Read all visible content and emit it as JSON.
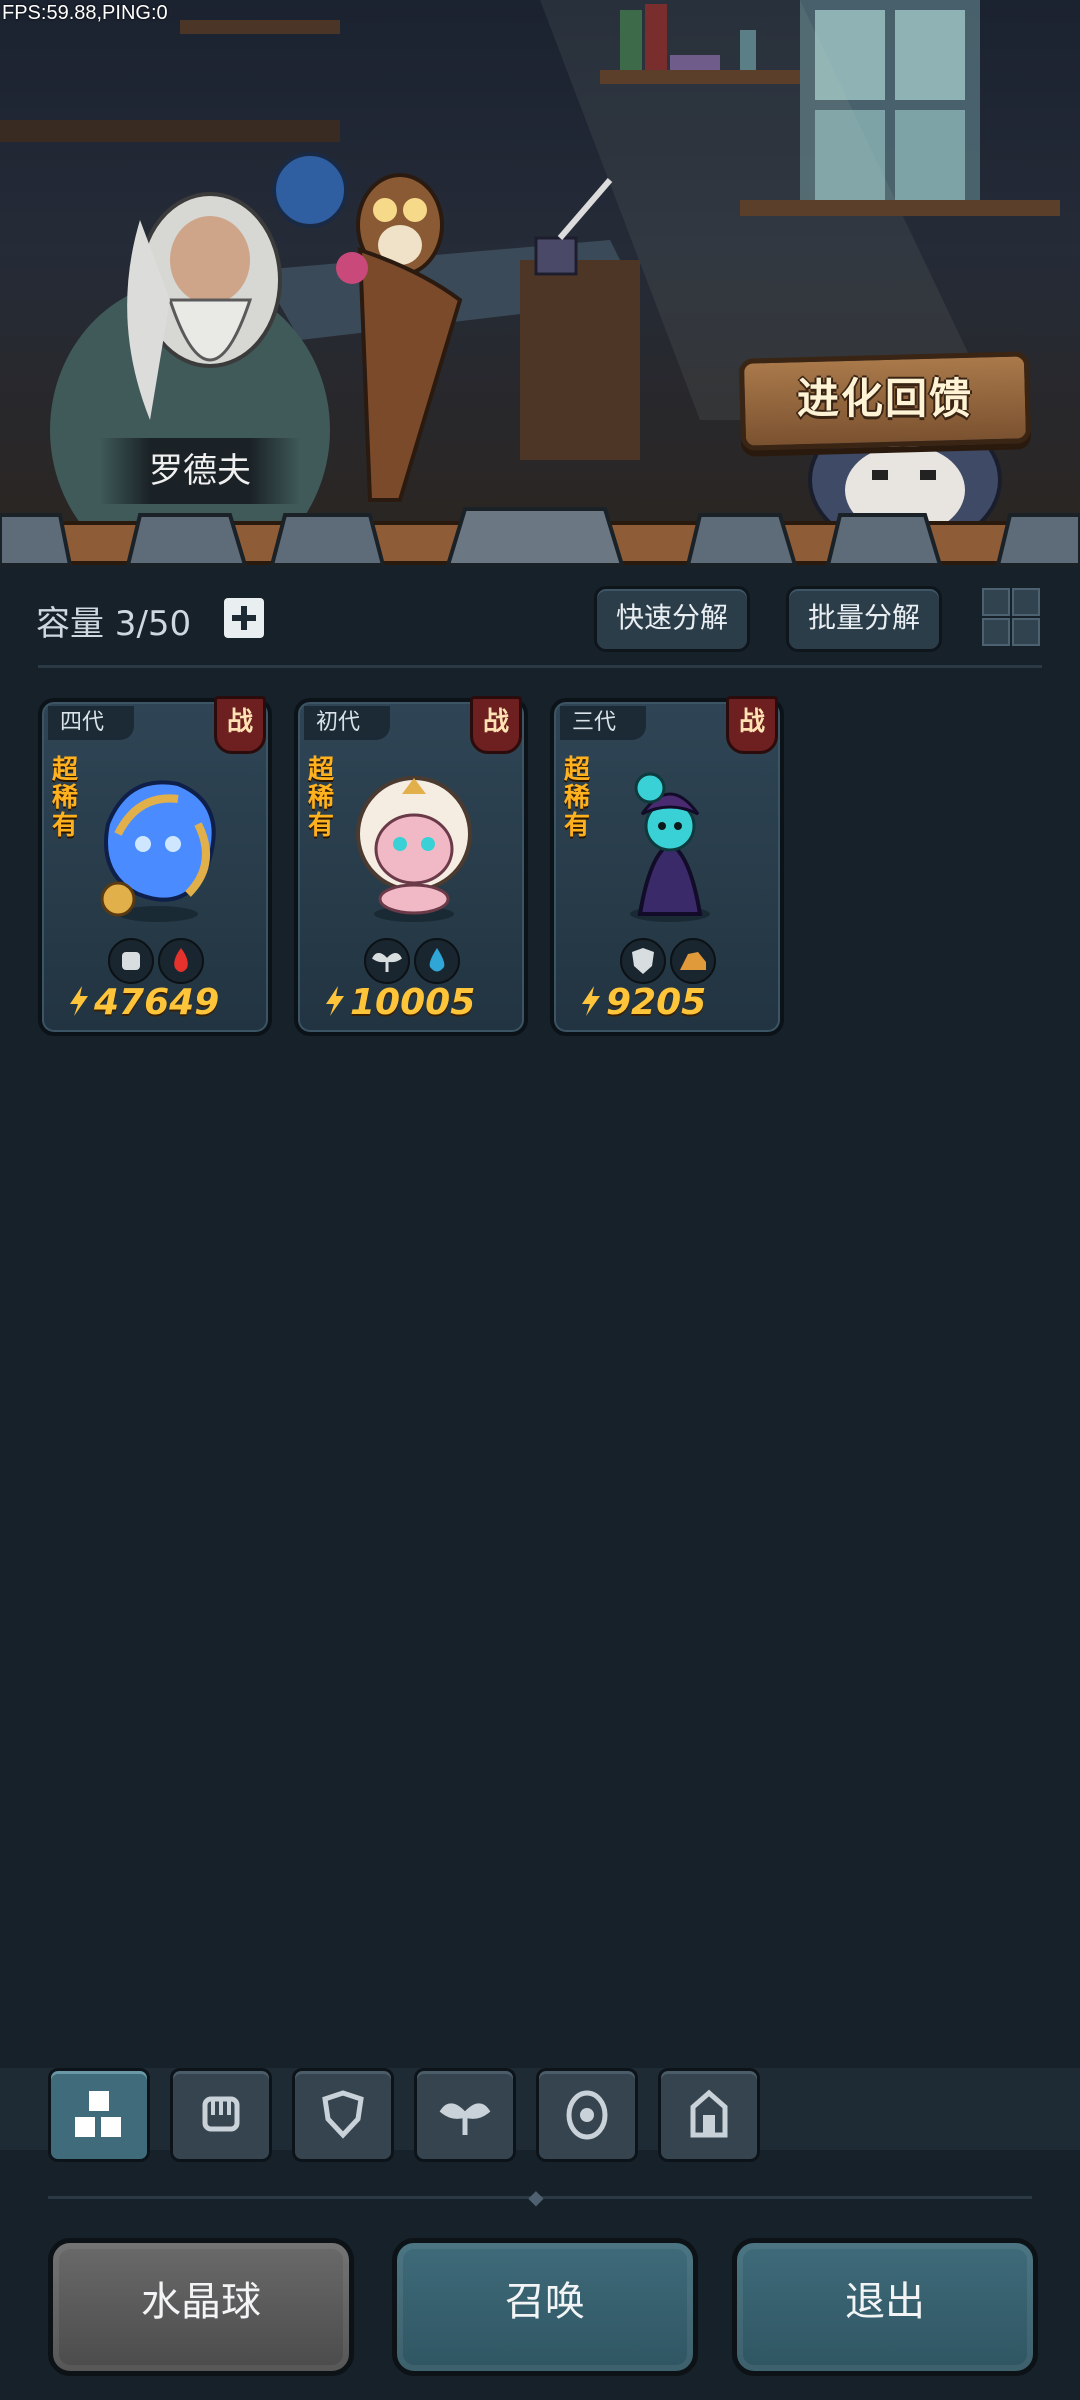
{
  "debug": {
    "fps_text": "FPS:59.88,PING:0"
  },
  "scene": {
    "npc_name": "罗德夫",
    "evolution_sign": "进化回馈"
  },
  "inventory": {
    "capacity_label": "容量 3/50",
    "quick_decompose": "快速分解",
    "batch_decompose": "批量分解"
  },
  "cards": [
    {
      "generation": "四代",
      "battle": "战",
      "rarity": "超稀有",
      "power": "47649",
      "traits": [
        "fist-icon",
        "fire-icon"
      ],
      "accent": "#4a8cff"
    },
    {
      "generation": "初代",
      "battle": "战",
      "rarity": "超稀有",
      "power": "10005",
      "traits": [
        "sprout-icon",
        "water-drop-icon"
      ],
      "accent": "#f1b8c6"
    },
    {
      "generation": "三代",
      "battle": "战",
      "rarity": "超稀有",
      "power": "9205",
      "traits": [
        "shield-icon",
        "earth-icon"
      ],
      "accent": "#3ad1d6"
    }
  ],
  "tabs": [
    "all-icon",
    "fist-icon",
    "shield-icon",
    "sprout-icon",
    "spirit-icon",
    "tower-icon"
  ],
  "buttons": {
    "crystal_ball": "水晶球",
    "summon": "召唤",
    "exit": "退出"
  },
  "colors": {
    "power": "#ffc53a",
    "rarity": "#ffb21e",
    "battle_badge": "#6e1f1f",
    "active_tab": "#3f6b7a"
  }
}
